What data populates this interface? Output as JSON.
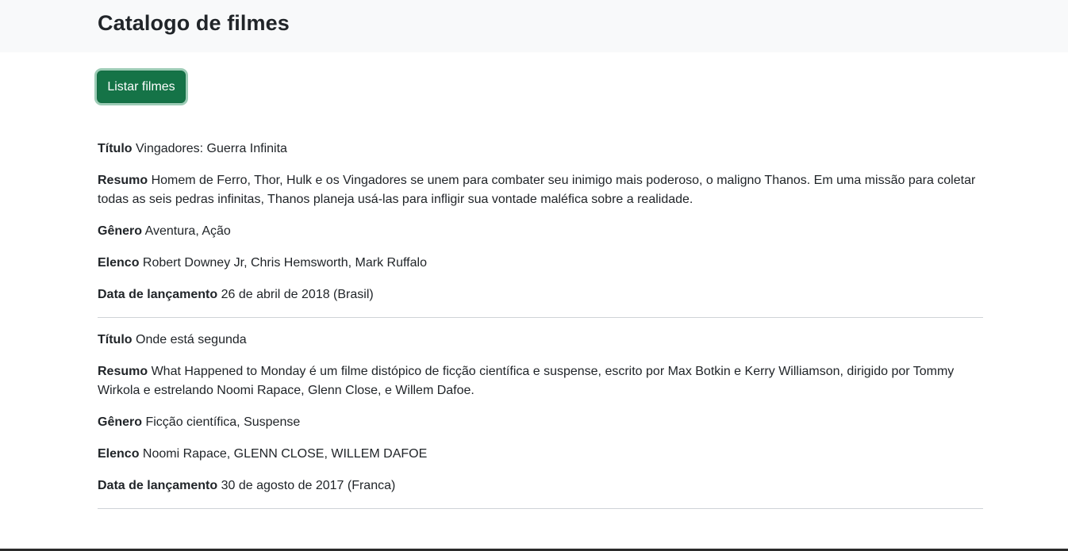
{
  "header": {
    "title": "Catalogo de filmes"
  },
  "actions": {
    "list_label": "Listar filmes"
  },
  "movies": [
    {
      "title_label": "Título",
      "title": "Vingadores: Guerra Infinita",
      "summary_label": "Resumo",
      "summary": "Homem de Ferro, Thor, Hulk e os Vingadores se unem para combater seu inimigo mais poderoso, o maligno Thanos. Em uma missão para coletar todas as seis pedras infinitas, Thanos planeja usá-las para infligir sua vontade maléfica sobre a realidade.",
      "genre_label": "Gênero",
      "genre": "Aventura, Ação",
      "cast_label": "Elenco",
      "cast": "Robert Downey Jr, Chris Hemsworth, Mark Ruffalo",
      "release_label": "Data de lançamento",
      "release": "26 de abril de 2018 (Brasil)"
    },
    {
      "title_label": "Título",
      "title": "Onde está segunda",
      "summary_label": "Resumo",
      "summary": "What Happened to Monday é um filme distópico de ficção científica e suspense, escrito por Max Botkin e Kerry Williamson, dirigido por Tommy Wirkola e estrelando Noomi Rapace, Glenn Close, e Willem Dafoe.",
      "genre_label": "Gênero",
      "genre": "Ficção científica, Suspense",
      "cast_label": "Elenco",
      "cast": "Noomi Rapace, GLENN CLOSE, WILLEM DAFOE",
      "release_label": "Data de lançamento",
      "release": "30 de agosto de 2017 (Franca)"
    }
  ],
  "colors": {
    "header_bg": "#f8f9fa",
    "button_bg": "#157347",
    "divider": "#cfd3d7",
    "text": "#212529"
  }
}
